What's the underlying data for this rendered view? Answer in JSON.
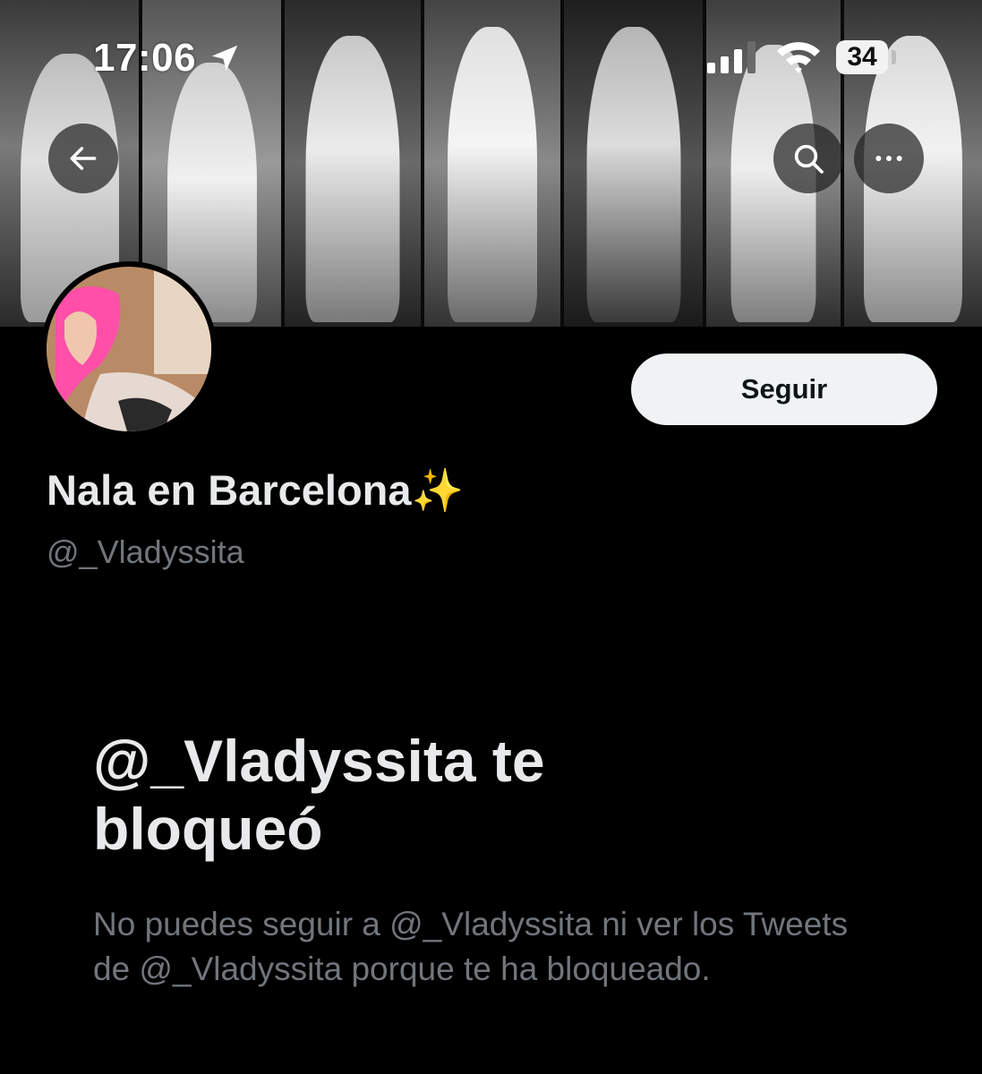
{
  "status_bar": {
    "time": "17:06",
    "battery": "34"
  },
  "header": {
    "back_icon": "arrow-left-icon",
    "search_icon": "search-icon",
    "more_icon": "more-horizontal-icon"
  },
  "profile": {
    "display_name": "Nala en Barcelona✨",
    "handle": "@_Vladyssita",
    "follow_label": "Seguir"
  },
  "blocked": {
    "title": "@_Vladyssita te bloqueó",
    "description": "No puedes seguir a @_Vladyssita ni ver los Tweets de @_Vladyssita porque te ha bloqueado."
  },
  "colors": {
    "background": "#000000",
    "primary_text": "#e7e9ea",
    "secondary_text": "#71767b",
    "button_bg": "#eff3f4"
  }
}
